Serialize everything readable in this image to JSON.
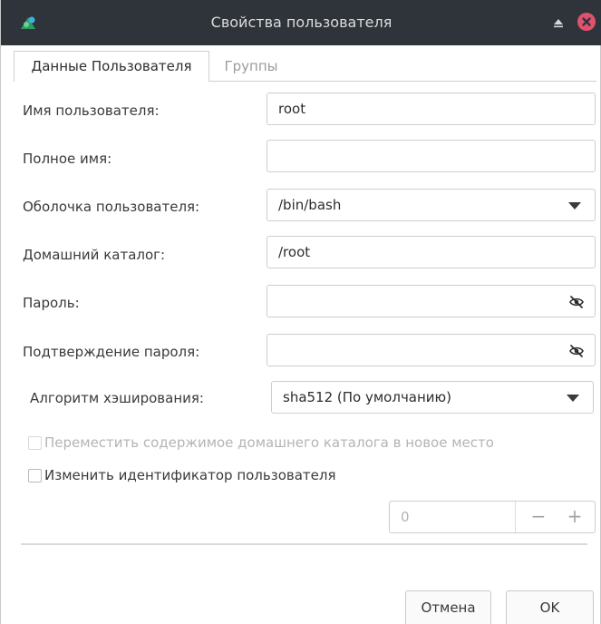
{
  "window": {
    "title": "Свойства пользователя",
    "icons": {
      "app": "user-properties-app-icon",
      "roll_up": "roll-up-icon",
      "close": "close-icon"
    }
  },
  "tabs": [
    {
      "label": "Данные Пользователя",
      "active": true
    },
    {
      "label": "Группы",
      "active": false
    }
  ],
  "form": {
    "username": {
      "label": "Имя пользователя:",
      "value": "root"
    },
    "fullname": {
      "label": "Полное имя:",
      "value": ""
    },
    "shell": {
      "label": "Оболочка пользователя:",
      "value": "/bin/bash"
    },
    "home": {
      "label": "Домашний каталог:",
      "value": "/root"
    },
    "password": {
      "label": "Пароль:",
      "value": ""
    },
    "password_confirm": {
      "label": "Подтверждение пароля:",
      "value": ""
    },
    "hash_algorithm": {
      "label": "Алгоритм хэширования:",
      "value": "sha512 (По умолчанию)"
    },
    "move_home": {
      "label": "Переместить содержимое домашнего каталога в новое место",
      "checked": false,
      "enabled": false
    },
    "change_uid": {
      "label": "Изменить идентификатор пользователя",
      "checked": false,
      "enabled": true
    },
    "uid": {
      "value": "0",
      "minus": "−",
      "plus": "+"
    }
  },
  "buttons": {
    "cancel": "Отмена",
    "ok": "OK"
  },
  "colors": {
    "titlebar": "#2f343a",
    "close": "#e0516d",
    "border": "#cdcdcd"
  }
}
